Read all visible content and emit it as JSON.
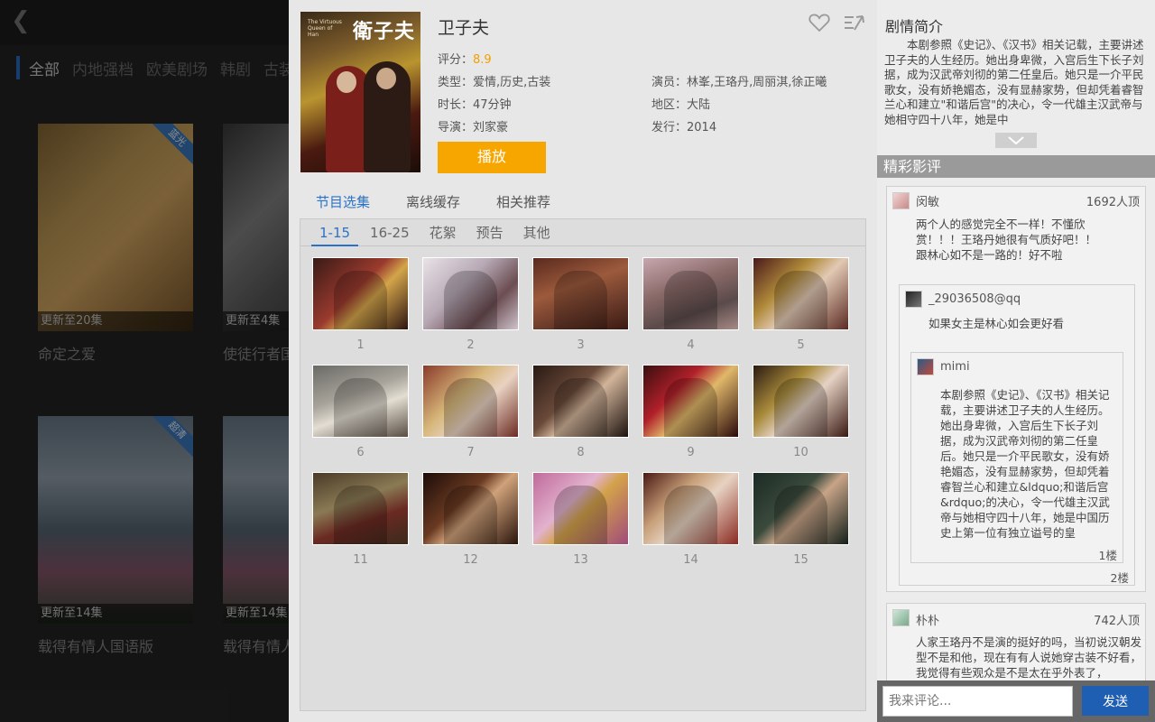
{
  "background": {
    "back_icon": "chevron-left-icon",
    "categories": [
      "全部",
      "内地强档",
      "欧美剧场",
      "韩剧",
      "古装"
    ],
    "cards": [
      {
        "title": "命定之爱",
        "update": "更新至20集",
        "ribbon": "蓝光"
      },
      {
        "title": "使徒行者国语版",
        "update": "更新至4集",
        "ribbon": ""
      },
      {
        "title": "载得有情人国语版",
        "update": "更新至14集",
        "ribbon": "超清"
      },
      {
        "title": "载得有情人",
        "update": "更新至14集",
        "ribbon": ""
      }
    ]
  },
  "detail": {
    "title": "卫子夫",
    "poster_title": "衛子夫",
    "poster_subtitle": "The Virtuous Queen of Han",
    "score_label": "评分：",
    "score": "8.9",
    "genre": "类型：爱情,历史,古装",
    "duration": "时长：47分钟",
    "director": "导演：刘家豪",
    "cast": "演员：林峯,王珞丹,周丽淇,徐正曦",
    "region": "地区：大陆",
    "release": "发行：2014",
    "play_label": "播放",
    "favorite_icon": "heart-icon",
    "share_icon": "share-icon",
    "tabs": [
      "节目选集",
      "离线缓存",
      "相关推荐"
    ],
    "active_tab": 0,
    "ranges": [
      "1-15",
      "16-25",
      "花絮",
      "预告",
      "其他"
    ],
    "active_range": 0,
    "episodes": [
      "1",
      "2",
      "3",
      "4",
      "5",
      "6",
      "7",
      "8",
      "9",
      "10",
      "11",
      "12",
      "13",
      "14",
      "15"
    ],
    "accent_color": "#2a72c9",
    "play_color": "#f7a600"
  },
  "synopsis": {
    "title": "剧情简介",
    "text": "本剧参照《史记》、《汉书》相关记载，主要讲述卫子夫的人生经历。她出身卑微，入宫后生下长子刘据，成为汉武帝刘彻的第二任皇后。她只是一介平民歌女，没有娇艳媚态，没有显赫家势，但却凭着睿智兰心和建立\"和谐后宫\"的决心，令一代雄主汉武帝与她相守四十八年，她是中",
    "expand_icon": "chevron-down-icon"
  },
  "reviews": {
    "title": "精彩影评",
    "items": [
      {
        "user": "闵敏",
        "likes": "1692人顶",
        "text": "两个人的感觉完全不一样！不懂欣赏！！！王珞丹她很有气质好吧！！跟林心如不是一路的！好不啦",
        "reply": {
          "user": "_29036508@qq",
          "text": "如果女主是林心如会更好看",
          "floor": "2楼",
          "reply": {
            "user": "mimi",
            "text": "本剧参照《史记》、《汉书》相关记载，主要讲述卫子夫的人生经历。她出身卑微，入宫后生下长子刘据，成为汉武帝刘彻的第二任皇后。她只是一介平民歌女，没有娇艳媚态，没有显赫家势，但却凭着睿智兰心和建立&ldquo;和谐后宫&rdquo;的决心，令一代雄主汉武帝与她相守四十八年，她是中国历史上第一位有独立谥号的皇",
            "floor": "1楼"
          }
        }
      },
      {
        "user": "朴朴",
        "likes": "742人顶",
        "text": "人家王珞丹不是演的挺好的吗，当初说汉朝发型不是和他，现在有有人说她穿古装不好看，我觉得有些观众是不是太在乎外表了，"
      }
    ]
  },
  "comment": {
    "placeholder": "我来评论...",
    "send_label": "发送"
  }
}
